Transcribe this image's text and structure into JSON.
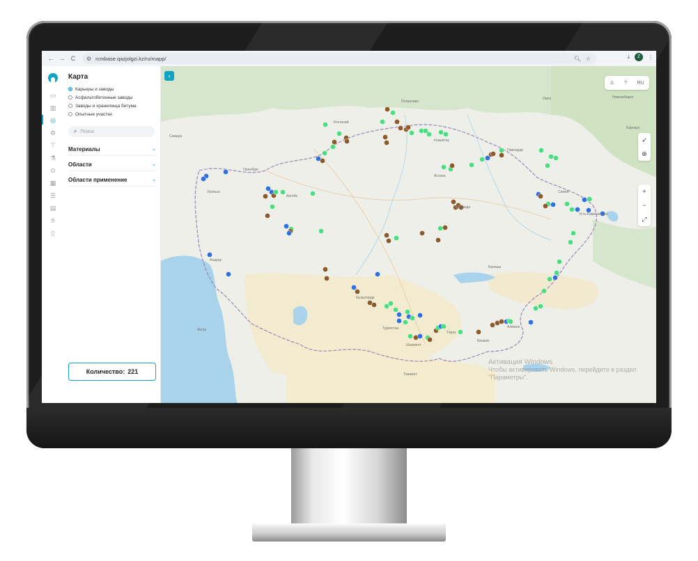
{
  "browser": {
    "url": "rcmbase.qazjolgzi.kz/ru/mapp/",
    "back_glyph": "←",
    "forward_glyph": "→",
    "reload_glyph": "C",
    "profile_initial": "2"
  },
  "sidebar": {
    "title": "Карта",
    "radio_options": [
      {
        "label": "Карьеры и заводы",
        "selected": true
      },
      {
        "label": "Асфальтобетонные заводы",
        "selected": false
      },
      {
        "label": "Заводы и хранилища битума",
        "selected": false
      },
      {
        "label": "Опытные участки",
        "selected": false
      }
    ],
    "search_placeholder": "Поиск",
    "sections": [
      "Материалы",
      "Области",
      "Области применение"
    ],
    "count_label": "Количество:",
    "count_value": "221"
  },
  "map": {
    "language": "RU",
    "watermark_line1": "Активация Windows",
    "watermark_line2": "Чтобы активировать Windows, перейдите в раздел \"Параметры\".",
    "marker_colors": {
      "quarry": "#8b5a2b",
      "plant": "#4ade80",
      "bitumen": "#2f6fe0"
    },
    "places": [
      "Петропавл",
      "Костанай",
      "Кокшетау",
      "Павлодар",
      "Астана",
      "Уральск",
      "Актобе",
      "Атырау",
      "Караганда",
      "Семей",
      "Усть-Каменогорск",
      "Кызылорда",
      "Шымкент",
      "Тараз",
      "Алматы",
      "Оренбург",
      "Самара",
      "Омск",
      "Новосибирск",
      "Барнаул",
      "Бишкек",
      "Ташкент",
      "Актау",
      "Туркестан",
      "Балхаш"
    ]
  }
}
